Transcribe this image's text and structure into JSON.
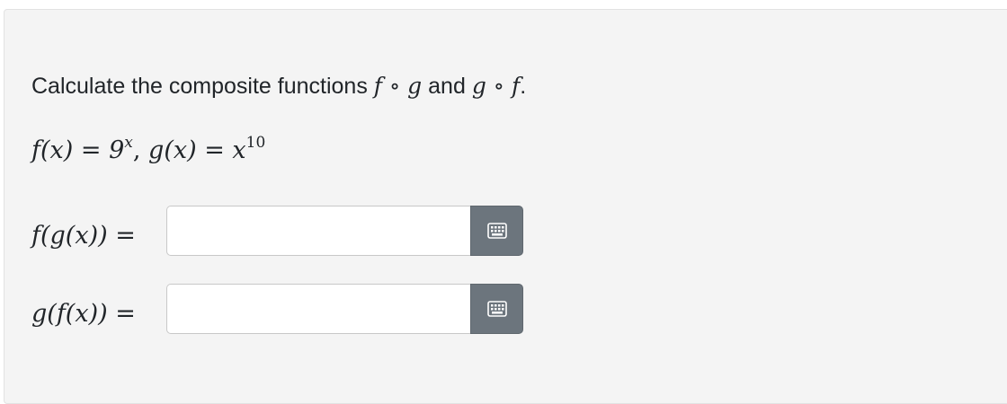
{
  "question": {
    "prompt_text": "Calculate the composite functions",
    "prompt_math_1": "f ∘ g",
    "prompt_and": "and",
    "prompt_math_2": "g ∘ f",
    "prompt_end": ".",
    "given": {
      "f_def": "f(x) = 9",
      "f_exp": "x",
      "sep": ", ",
      "g_def": "g(x) = x",
      "g_exp": "10"
    }
  },
  "answers": [
    {
      "label": "f(g(x)) =",
      "value": "",
      "placeholder": "",
      "button_icon": "keyboard-icon"
    },
    {
      "label": "g(f(x)) =",
      "value": "",
      "placeholder": "",
      "button_icon": "keyboard-icon"
    }
  ],
  "colors": {
    "panel_bg": "#f4f4f4",
    "button_bg": "#6c757d",
    "text": "#212529"
  }
}
